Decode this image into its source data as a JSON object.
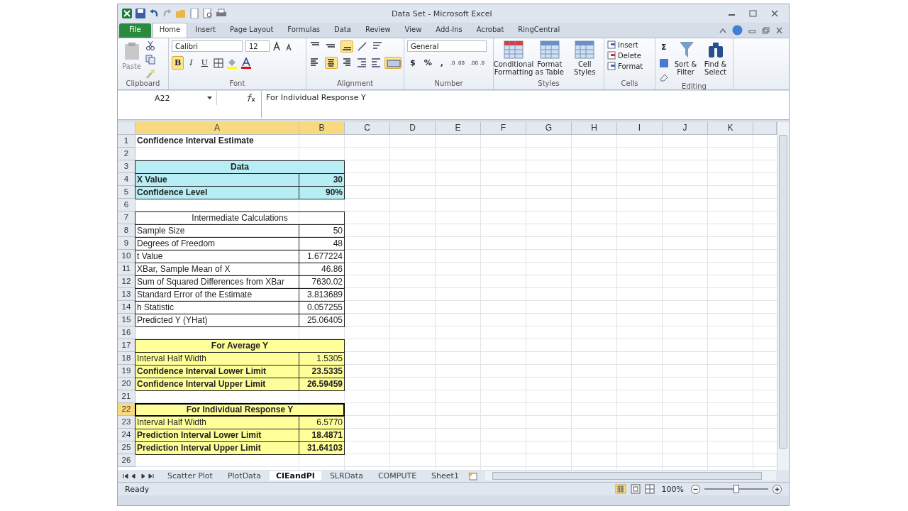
{
  "window": {
    "title": "Data Set - Microsoft Excel"
  },
  "tabs": [
    {
      "label": "File",
      "kind": "file",
      "selected": false
    },
    {
      "label": "Home",
      "kind": "tab",
      "selected": true
    },
    {
      "label": "Insert",
      "kind": "tab",
      "selected": false
    },
    {
      "label": "Page Layout",
      "kind": "tab",
      "selected": false
    },
    {
      "label": "Formulas",
      "kind": "tab",
      "selected": false
    },
    {
      "label": "Data",
      "kind": "tab",
      "selected": false
    },
    {
      "label": "Review",
      "kind": "tab",
      "selected": false
    },
    {
      "label": "View",
      "kind": "tab",
      "selected": false
    },
    {
      "label": "Add-Ins",
      "kind": "tab",
      "selected": false
    },
    {
      "label": "Acrobat",
      "kind": "tab",
      "selected": false
    },
    {
      "label": "RingCentral",
      "kind": "tab",
      "selected": false
    }
  ],
  "ribbon": {
    "clipboard": {
      "paste": "Paste",
      "label": "Clipboard"
    },
    "font": {
      "name": "Calibri",
      "size": "12",
      "label": "Font",
      "buttons": [
        {
          "label": "B",
          "selected": true
        },
        {
          "label": "I",
          "selected": false
        },
        {
          "label": "U",
          "selected": false
        }
      ]
    },
    "alignment": {
      "label": "Alignment",
      "top": [
        {
          "kind": "top",
          "on": false
        },
        {
          "kind": "middle",
          "on": false
        },
        {
          "kind": "bottom",
          "on": true
        }
      ],
      "bottom": [
        {
          "kind": "left",
          "on": false
        },
        {
          "kind": "center",
          "on": true
        },
        {
          "kind": "right",
          "on": false
        }
      ],
      "merge_on": true
    },
    "number": {
      "format": "General",
      "symbols": [
        "$",
        "%",
        ","
      ],
      "decimals": [
        ".0 .00",
        ".00 .0"
      ],
      "label": "Number"
    },
    "styles": {
      "label": "Styles",
      "buttons": [
        "Conditional Formatting",
        "Format as Table",
        "Cell Styles"
      ]
    },
    "cells": {
      "label": "Cells",
      "buttons": [
        "Insert",
        "Delete",
        "Format"
      ]
    },
    "editing": {
      "label": "Editing",
      "sum": "Σ",
      "buttons": [
        "Sort & Filter",
        "Find & Select"
      ]
    }
  },
  "formula_bar": {
    "name_box": "A22",
    "formula": "For Individual Response Y"
  },
  "columns": [
    {
      "label": "A",
      "selected": true
    },
    {
      "label": "B",
      "selected": true
    },
    {
      "label": "C",
      "selected": false
    },
    {
      "label": "D",
      "selected": false
    },
    {
      "label": "E",
      "selected": false
    },
    {
      "label": "F",
      "selected": false
    },
    {
      "label": "G",
      "selected": false
    },
    {
      "label": "H",
      "selected": false
    },
    {
      "label": "I",
      "selected": false
    },
    {
      "label": "J",
      "selected": false
    },
    {
      "label": "K",
      "selected": false
    }
  ],
  "rows": [
    {
      "n": "1",
      "a": "Confidence Interval Estimate",
      "bold": true,
      "merged": false,
      "boxed": false,
      "selected": false
    },
    {
      "n": "2",
      "selected": false
    },
    {
      "n": "3",
      "a": "Data",
      "bold": true,
      "merged": true,
      "boxed": true,
      "color": "#b7eef5",
      "selected": false
    },
    {
      "n": "4",
      "a": "X Value",
      "b": "30",
      "bold": true,
      "merged": false,
      "boxed": true,
      "color": "#b7eef5",
      "selected": false
    },
    {
      "n": "5",
      "a": "Confidence Level",
      "b": "90%",
      "bold": true,
      "merged": false,
      "boxed": true,
      "color": "#b7eef5",
      "selected": false
    },
    {
      "n": "6",
      "selected": false
    },
    {
      "n": "7",
      "a": "Intermediate Calculations",
      "bold": false,
      "merged": true,
      "boxed": true,
      "selected": false
    },
    {
      "n": "8",
      "a": "Sample Size",
      "b": "50",
      "bold": false,
      "merged": false,
      "boxed": true,
      "selected": false
    },
    {
      "n": "9",
      "a": "Degrees of Freedom",
      "b": "48",
      "bold": false,
      "merged": false,
      "boxed": true,
      "selected": false
    },
    {
      "n": "10",
      "a": "t Value",
      "b": "1.677224",
      "bold": false,
      "merged": false,
      "boxed": true,
      "selected": false
    },
    {
      "n": "11",
      "a": "XBar, Sample Mean of X",
      "b": "46.86",
      "bold": false,
      "merged": false,
      "boxed": true,
      "selected": false
    },
    {
      "n": "12",
      "a": "Sum of Squared Differences from XBar",
      "b": "7630.02",
      "bold": false,
      "merged": false,
      "boxed": true,
      "selected": false
    },
    {
      "n": "13",
      "a": "Standard Error of the Estimate",
      "b": "3.813689",
      "bold": false,
      "merged": false,
      "boxed": true,
      "selected": false
    },
    {
      "n": "14",
      "a": "h Statistic",
      "b": "0.057255",
      "bold": false,
      "merged": false,
      "boxed": true,
      "selected": false
    },
    {
      "n": "15",
      "a": "Predicted Y (YHat)",
      "b": "25.06405",
      "bold": false,
      "merged": false,
      "boxed": true,
      "selected": false
    },
    {
      "n": "16",
      "selected": false
    },
    {
      "n": "17",
      "a": "For Average Y",
      "bold": true,
      "merged": true,
      "boxed": true,
      "color": "#ffff99",
      "selected": false
    },
    {
      "n": "18",
      "a": "Interval Half Width",
      "b": "1.5305",
      "bold": false,
      "merged": false,
      "boxed": true,
      "color": "#ffff99",
      "selected": false
    },
    {
      "n": "19",
      "a": "Confidence Interval Lower Limit",
      "b": "23.5335",
      "bold": true,
      "merged": false,
      "boxed": true,
      "color": "#ffff99",
      "selected": false
    },
    {
      "n": "20",
      "a": "Confidence Interval Upper Limit",
      "b": "26.59459",
      "bold": true,
      "merged": false,
      "boxed": true,
      "color": "#ffff99",
      "selected": false
    },
    {
      "n": "21",
      "selected": false
    },
    {
      "n": "22",
      "a": "For Individual Response Y",
      "bold": true,
      "merged": true,
      "boxed": true,
      "color": "#ffff99",
      "selected": true
    },
    {
      "n": "23",
      "a": "Interval Half Width",
      "b": "6.5770",
      "bold": false,
      "merged": false,
      "boxed": true,
      "color": "#ffff99",
      "selected": false
    },
    {
      "n": "24",
      "a": "Prediction Interval Lower Limit",
      "b": "18.4871",
      "bold": true,
      "merged": false,
      "boxed": true,
      "color": "#ffff99",
      "selected": false
    },
    {
      "n": "25",
      "a": "Prediction Interval Upper Limit",
      "b": "31.64103",
      "bold": true,
      "merged": false,
      "boxed": true,
      "color": "#ffff99",
      "selected": false
    },
    {
      "n": "26",
      "selected": false
    }
  ],
  "sheet_tabs": [
    {
      "label": "Scatter Plot",
      "selected": false
    },
    {
      "label": "PlotData",
      "selected": false
    },
    {
      "label": "CIEandPI",
      "selected": true
    },
    {
      "label": "SLRData",
      "selected": false
    },
    {
      "label": "COMPUTE",
      "selected": false
    },
    {
      "label": "Sheet1",
      "selected": false
    }
  ],
  "status_bar": {
    "text": "Ready",
    "zoom": "100%",
    "zoom_level": {
      "level": 0.5
    }
  }
}
